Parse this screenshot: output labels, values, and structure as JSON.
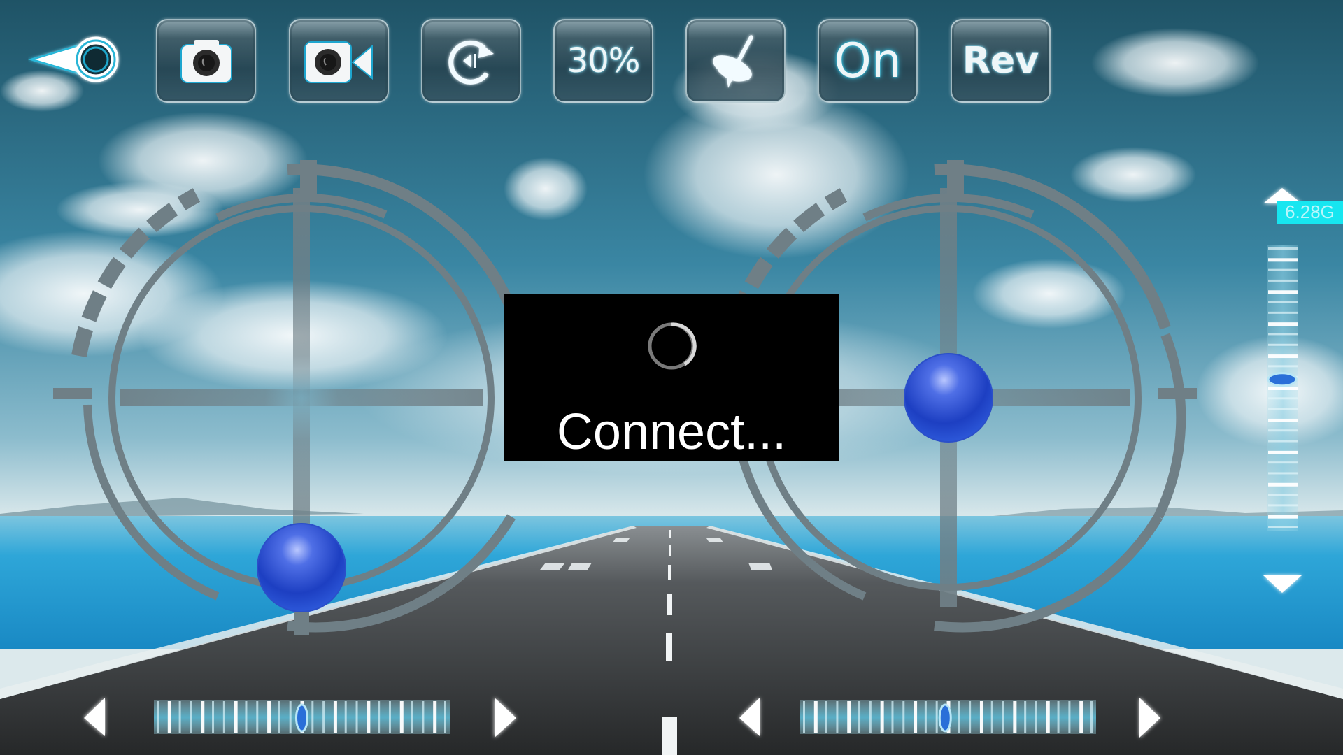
{
  "app": {
    "screen": "flight-control"
  },
  "toolbar": {
    "back": {
      "icon": "back-arrow-ring-icon"
    },
    "buttons": [
      {
        "id": "photo",
        "icon": "camera-icon",
        "label": ""
      },
      {
        "id": "video",
        "icon": "video-camera-icon",
        "label": ""
      },
      {
        "id": "flip",
        "icon": "rotate-flip-icon",
        "label": ""
      },
      {
        "id": "speed",
        "icon": "",
        "label": "30%"
      },
      {
        "id": "gyro-calibrate",
        "icon": "spinning-top-icon",
        "label": ""
      },
      {
        "id": "headless",
        "icon": "",
        "label": "On"
      },
      {
        "id": "reverse",
        "icon": "",
        "label": "Rev"
      }
    ]
  },
  "dialog": {
    "message": "Connect...",
    "spinner": "loading-spinner-icon"
  },
  "altitude": {
    "label": "6.28G",
    "trim_position": 0.47
  },
  "joysticks": {
    "left": {
      "x": 0.0,
      "y": -0.9
    },
    "right": {
      "x": 0.0,
      "y": 0.0
    }
  },
  "trims": {
    "left": {
      "position": 0.5
    },
    "right": {
      "position": 0.49
    }
  },
  "colors": {
    "accent": "#17e6f0",
    "ring": "#6f7f86",
    "ball": "#2a4fd0",
    "trim_glow": "#5fd3ea"
  }
}
